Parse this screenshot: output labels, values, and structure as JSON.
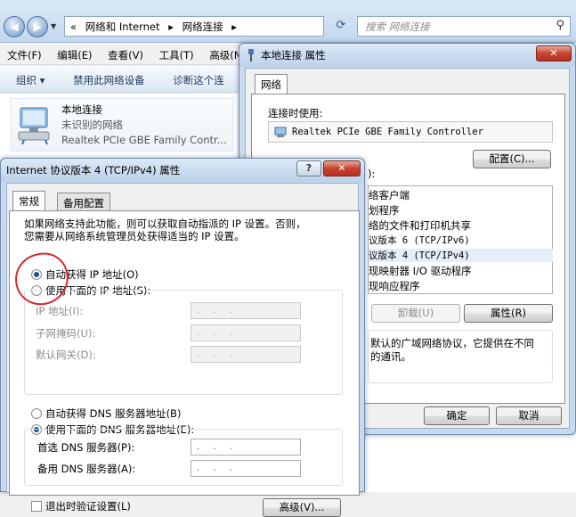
{
  "explorer": {
    "address_prefix": "«",
    "address_segments": [
      "网络和 Internet",
      "▸",
      "网络连接",
      "▸"
    ],
    "search_placeholder": "搜索 网络连接",
    "menu": [
      "文件(F)",
      "编辑(E)",
      "查看(V)",
      "工具(T)",
      "高级(N"
    ],
    "commands": [
      "组织 ▾",
      "禁用此网络设备",
      "诊断这个连"
    ],
    "connection": {
      "name": "本地连接",
      "status": "未识别的网络",
      "adapter": "Realtek PCIe GBE Family Contr..."
    }
  },
  "props_window": {
    "title": "本地连接 属性",
    "close_glyph": "✕",
    "tab": "网络",
    "connect_using_label": "连接时使用:",
    "adapter": "Realtek PCIe GBE Family Controller",
    "configure_button": "配置(C)...",
    "items_label_tail": "):",
    "items": [
      "络客户端",
      "划程序",
      "络的文件和打印机共享",
      "议版本 6 (TCP/IPv6)",
      "议版本 4 (TCP/IPv4)",
      "现映射器 I/O 驱动程序",
      "现响应程序"
    ],
    "uninstall_button": "卸载(U)",
    "properties_button": "属性(R)",
    "description_lines": [
      "默认的广域网络协议，它提供在不同",
      "的通讯。"
    ],
    "ok_button": "确定",
    "cancel_button": "取消"
  },
  "ipv4_window": {
    "title": "Internet 协议版本 4 (TCP/IPv4) 属性",
    "help_glyph": "?",
    "close_glyph": "✕",
    "tabs": [
      "常规",
      "备用配置"
    ],
    "intro_lines": [
      "如果网络支持此功能，则可以获取自动指派的 IP 设置。否则，",
      "您需要从网络系统管理员处获得适当的 IP 设置。"
    ],
    "auto_ip": "自动获得 IP 地址(O)",
    "manual_ip": "使用下面的 IP 地址(S):",
    "ip_address_label": "IP 地址(I):",
    "subnet_label": "子网掩码(U):",
    "gateway_label": "默认网关(D):",
    "ip_placeholder": ". . .",
    "auto_dns": "自动获得 DNS 服务器地址(B)",
    "manual_dns": "使用下面的 DNS 服务器地址(E):",
    "preferred_dns_label": "首选 DNS 服务器(P):",
    "alternate_dns_label": "备用 DNS 服务器(A):",
    "validate_exit": "退出时验证设置(L)",
    "advanced_button": "高级(V)..."
  }
}
